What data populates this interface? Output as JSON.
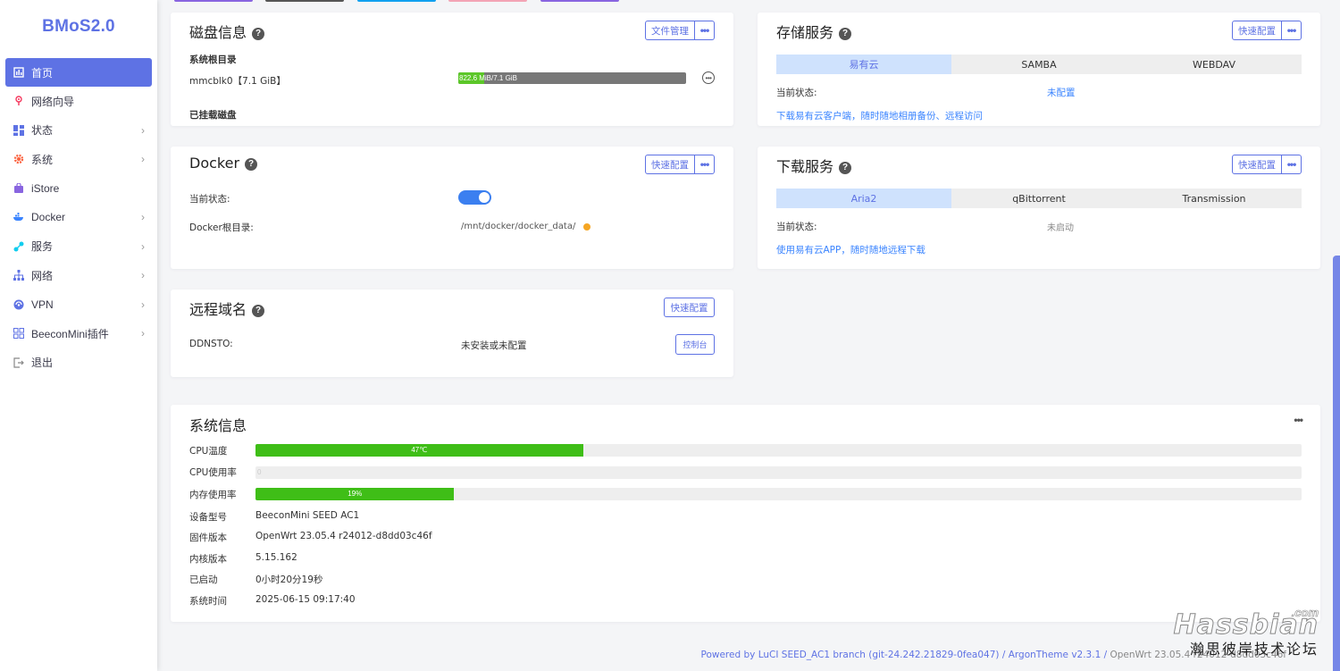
{
  "app": {
    "logo": "BMoS2.0"
  },
  "colors": {
    "accent": "#5e72e4",
    "progress_green": "#3fbe17",
    "link_blue": "#3a84ff",
    "toggle_on": "#3b7ff0",
    "tab_selected_bg": "#cfe2fd"
  },
  "sidebar": {
    "items": [
      {
        "label": "首页",
        "icon": "home-icon",
        "active": true
      },
      {
        "label": "网络向导",
        "icon": "network-wizard-icon"
      },
      {
        "label": "状态",
        "icon": "grid-icon"
      },
      {
        "label": "系统",
        "icon": "gear-icon"
      },
      {
        "label": "iStore",
        "icon": "store-icon"
      },
      {
        "label": "Docker",
        "icon": "docker-icon"
      },
      {
        "label": "服务",
        "icon": "services-icon"
      },
      {
        "label": "网络",
        "icon": "sitemap-icon"
      },
      {
        "label": "VPN",
        "icon": "vpn-icon"
      },
      {
        "label": "BeeconMini插件",
        "icon": "plugin-icon"
      },
      {
        "label": "退出",
        "icon": "logout-icon"
      }
    ]
  },
  "disk": {
    "title": "磁盘信息",
    "file_manager": "文件管理",
    "root_label": "系统根目录",
    "device": "mmcblk0【7.1 GiB】",
    "usage_text": "822.6 MiB/7.1 GiB",
    "usage_fraction": 0.113,
    "mounted_label": "已挂载磁盘"
  },
  "storage": {
    "title": "存储服务",
    "quick_config": "快速配置",
    "tabs": [
      "易有云",
      "SAMBA",
      "WEBDAV"
    ],
    "status_label": "当前状态:",
    "status_value": "未配置",
    "link": "下载易有云客户端，随时随地相册备份、远程访问"
  },
  "docker": {
    "title": "Docker",
    "quick_config": "快速配置",
    "status_label": "当前状态:",
    "status_on": true,
    "root_label": "Docker根目录:",
    "root_value": "/mnt/docker/docker_data/"
  },
  "download": {
    "title": "下载服务",
    "quick_config": "快速配置",
    "tabs": [
      "Aria2",
      "qBittorrent",
      "Transmission"
    ],
    "status_label": "当前状态:",
    "status_value": "未启动",
    "link": "使用易有云APP，随时随地远程下载"
  },
  "ddns": {
    "title": "远程域名",
    "quick_config": "快速配置",
    "label": "DDNSTO:",
    "value": "未安装或未配置",
    "console": "控制台"
  },
  "sysinfo": {
    "title": "系统信息",
    "cpu_temp_label": "CPU温度",
    "cpu_temp_text": "47℃",
    "cpu_temp_fraction": 0.313,
    "cpu_usage_label": "CPU使用率",
    "cpu_usage_text": "0",
    "cpu_usage_fraction": 0,
    "mem_label": "内存使用率",
    "mem_text": "19%",
    "mem_fraction": 0.19,
    "rows": [
      {
        "label": "设备型号",
        "value": "BeeconMini SEED AC1"
      },
      {
        "label": "固件版本",
        "value": "OpenWrt 23.05.4 r24012-d8dd03c46f"
      },
      {
        "label": "内核版本",
        "value": "5.15.162"
      },
      {
        "label": "已启动",
        "value": "0小时20分19秒"
      },
      {
        "label": "系统时间",
        "value": "2025-06-15 09:17:40"
      }
    ]
  },
  "footer": {
    "text": "Powered by LuCI SEED_AC1 branch (git-24.242.21829-0fea047) / ArgonTheme v2.3.1 / ",
    "tail": "OpenWrt 23.05.4 r24012-d8dd03c46f"
  },
  "watermark": {
    "brand": "Hassbian",
    "com": ".com",
    "cn": "瀚思彼岸技术论坛"
  }
}
